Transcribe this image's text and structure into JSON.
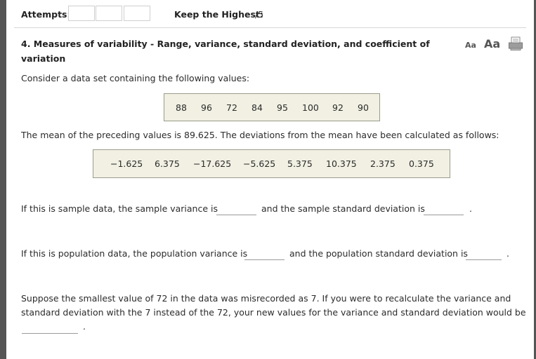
{
  "header": {
    "attempts_label": "Attempts:",
    "keep_label": "Keep the Highest:",
    "keep_score": "/5"
  },
  "question": {
    "title": "4. Measures of variability - Range, variance, standard deviation, and coefficient of variation",
    "font_small": "Aa",
    "font_large": "Aa",
    "intro": "Consider a data set containing the following values:",
    "values": [
      "88",
      "96",
      "72",
      "84",
      "95",
      "100",
      "92",
      "90"
    ],
    "mean_text": "The mean of the preceding values is 89.625. The deviations from the mean have been calculated as follows:",
    "deviations": [
      "−1.625",
      "6.375",
      "−17.625",
      "−5.625",
      "5.375",
      "10.375",
      "2.375",
      "0.375"
    ],
    "sample_text_1": "If this is sample data, the sample variance is",
    "sample_text_2": "and the sample standard deviation is",
    "population_text_1": "If this is population data, the population variance is",
    "population_text_2": "and the population standard deviation is",
    "misrecord_line_1": "Suppose the smallest value of 72 in the data was misrecorded as 7. If you were to recalculate the variance and",
    "misrecord_line_2": "standard deviation with the 7 instead of the 72, your new values for the variance and standard deviation would be",
    "period": "."
  }
}
